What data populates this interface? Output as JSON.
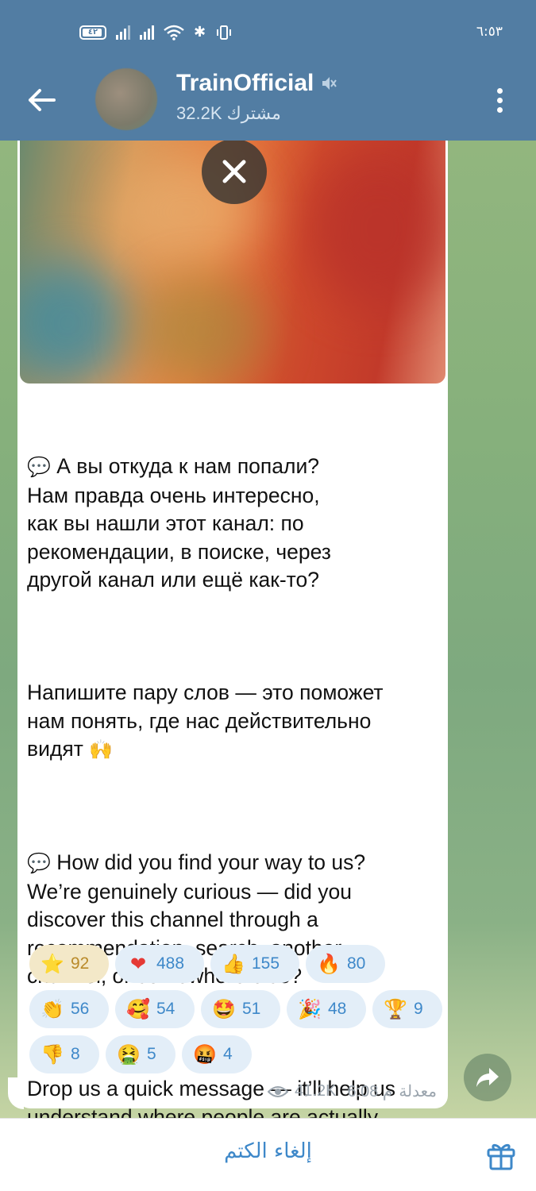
{
  "status_bar": {
    "battery": "٤٢",
    "time": "٦:٥٣"
  },
  "header": {
    "channel_name": "TrainOfficial",
    "subscribers": "32.2K مشترك"
  },
  "message": {
    "paragraphs": [
      "А вы откуда к нам попали?\nНам правда очень интересно,\nкак вы нашли этот канал: по\nрекомендации, в поиске, через\nдругой канал или ещё как-то?",
      "Напишите пару слов — это поможет\nнам понять, где нас действительно\nвидят",
      "How did you find your way to us?\nWe’re genuinely curious — did you\ndiscover this channel through a\nrecommendation, search, another\nchannel, or somewhere else?",
      "Drop us a quick message — it’ll help us\nunderstand where people are actually\nfinding us"
    ],
    "icons": {
      "speech_bubble": "💬",
      "raised_hands": "🙌"
    },
    "reactions": [
      {
        "emoji": "⭐",
        "name": "star-icon",
        "count": "92"
      },
      {
        "emoji": "❤",
        "name": "heart-icon",
        "count": "488"
      },
      {
        "emoji": "👍",
        "name": "thumbs-up-icon",
        "count": "155"
      },
      {
        "emoji": "🔥",
        "name": "fire-icon",
        "count": "80"
      },
      {
        "emoji": "👏",
        "name": "clapping-icon",
        "count": "56"
      },
      {
        "emoji": "🥰",
        "name": "smiling-hearts-icon",
        "count": "54"
      },
      {
        "emoji": "🤩",
        "name": "star-struck-icon",
        "count": "51"
      },
      {
        "emoji": "🎉",
        "name": "party-popper-icon",
        "count": "48"
      },
      {
        "emoji": "🏆",
        "name": "trophy-icon",
        "count": "9"
      },
      {
        "emoji": "👎",
        "name": "thumbs-down-icon",
        "count": "8"
      },
      {
        "emoji": "🤮",
        "name": "vomiting-face-icon",
        "count": "5"
      },
      {
        "emoji": "🤬",
        "name": "cursing-face-icon",
        "count": "4"
      }
    ],
    "views": "41.2K",
    "time": "6:08 م",
    "edited_label": "معدلة"
  },
  "bottom_bar": {
    "unmute_label": "إلغاء الكتم"
  },
  "colors": {
    "header_bg": "#527da3",
    "link_blue": "#3e88c9",
    "reaction_bg": "#e3eef8",
    "reaction_active_bg": "#f3e8c8"
  }
}
